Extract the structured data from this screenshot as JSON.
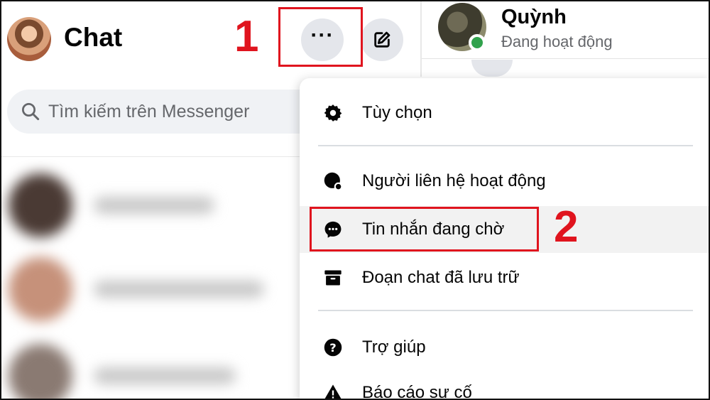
{
  "header": {
    "title": "Chat",
    "more_label": "···",
    "compose_icon": "compose-icon"
  },
  "search": {
    "placeholder": "Tìm kiếm trên Messenger"
  },
  "conversation": {
    "contact_name": "Quỳnh",
    "contact_status": "Đang hoạt động",
    "online_color": "#31a24c"
  },
  "menu": {
    "items": [
      {
        "label": "Tùy chọn",
        "icon": "gear-icon"
      },
      {
        "label": "Người liên hệ hoạt động",
        "icon": "active-contacts-icon"
      },
      {
        "label": "Tin nhắn đang chờ",
        "icon": "message-request-icon"
      },
      {
        "label": "Đoạn chat đã lưu trữ",
        "icon": "archive-icon"
      },
      {
        "label": "Trợ giúp",
        "icon": "help-icon"
      },
      {
        "label": "Báo cáo sự cố",
        "icon": "warning-icon"
      }
    ]
  },
  "annotations": {
    "step1": "1",
    "step2": "2",
    "color": "#e0141e"
  }
}
